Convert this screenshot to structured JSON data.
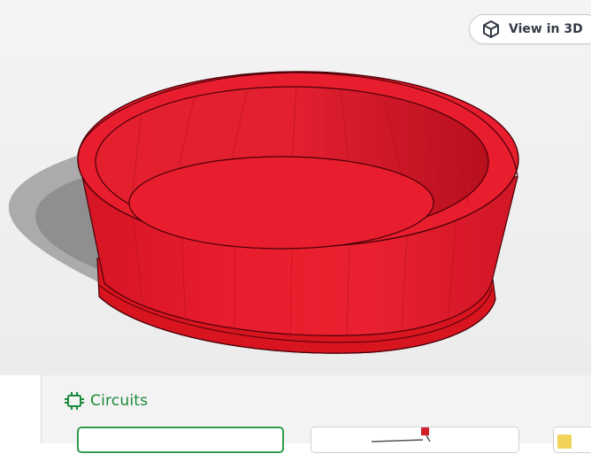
{
  "viewer": {
    "view_in_3d_label": "View in 3D",
    "view_in_3d_icon": "cube-icon",
    "model_color": "#e8202e"
  },
  "panel": {
    "section_title": "Circuits",
    "section_icon": "chip-icon",
    "accent_color": "#1b8a3a"
  }
}
